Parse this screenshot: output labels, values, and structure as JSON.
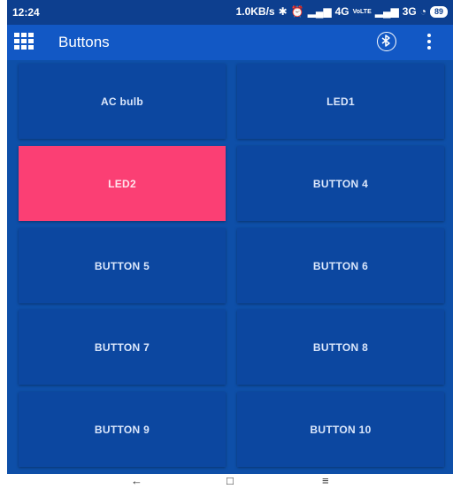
{
  "status_bar": {
    "time": "12:24",
    "net_speed": "1.0KB/s",
    "net_type_1": "4G",
    "volte": "VoLTE",
    "net_type_2": "3G",
    "battery": "89"
  },
  "app_bar": {
    "title": "Buttons",
    "menu_icon": "grid-menu-icon",
    "bluetooth_icon": "bluetooth-icon",
    "overflow_icon": "more-vert-icon"
  },
  "buttons": [
    {
      "label": "AC bulb",
      "active": false
    },
    {
      "label": "LED1",
      "active": false
    },
    {
      "label": "LED2",
      "active": true
    },
    {
      "label": "BUTTON 4",
      "active": false
    },
    {
      "label": "BUTTON 5",
      "active": false
    },
    {
      "label": "BUTTON 6",
      "active": false
    },
    {
      "label": "BUTTON 7",
      "active": false
    },
    {
      "label": "BUTTON 8",
      "active": false
    },
    {
      "label": "BUTTON 9",
      "active": false
    },
    {
      "label": "BUTTON 10",
      "active": false
    }
  ],
  "nav_bar": {
    "back_icon": "back-arrow-icon",
    "home_icon": "home-square-icon",
    "recents_icon": "recents-menu-icon"
  },
  "colors": {
    "status_bar": "#0d3f8f",
    "app_bar": "#1258c5",
    "background": "#0e4fa8",
    "tile": "#0c47a0",
    "tile_active": "#fb3f74"
  }
}
